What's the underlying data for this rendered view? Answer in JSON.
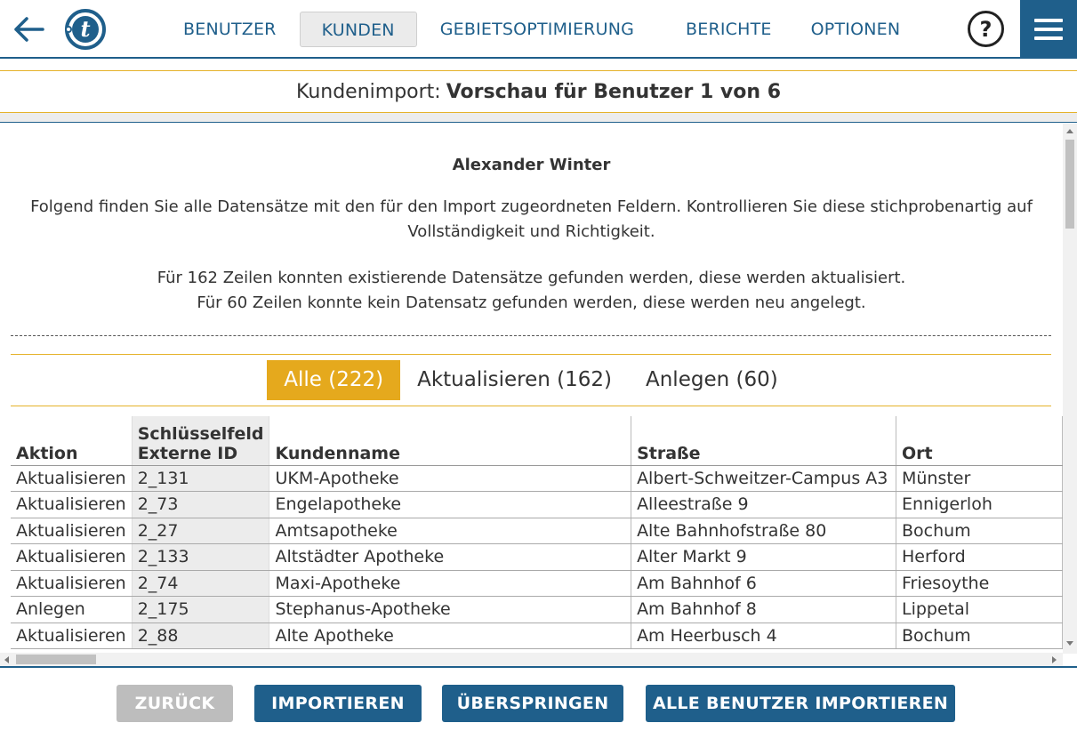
{
  "nav": {
    "items": [
      "BENUTZER",
      "KUNDEN",
      "GEBIETSOPTIMIERUNG",
      "BERICHTE",
      "OPTIONEN"
    ],
    "active": "KUNDEN",
    "help_label": "?",
    "logo_letter": "t"
  },
  "title": {
    "prefix": "Kundenimport:",
    "main": "Vorschau für Benutzer 1 von 6"
  },
  "content": {
    "user_name": "Alexander Winter",
    "description": "Folgend finden Sie alle Datensätze mit den für den Import zugeordneten Feldern. Kontrollieren Sie diese stichprobenartig auf Vollständigkeit und Richtigkeit.",
    "stat_update": "Für 162 Zeilen konnten existierende Datensätze gefunden werden, diese werden aktualisiert.",
    "stat_create": "Für 60 Zeilen konnte kein Datensatz gefunden werden, diese werden neu angelegt."
  },
  "filters": [
    {
      "label": "Alle (222)",
      "active": true
    },
    {
      "label": "Aktualisieren (162)",
      "active": false
    },
    {
      "label": "Anlegen (60)",
      "active": false
    }
  ],
  "table": {
    "headers": {
      "aktion": "Aktion",
      "key_line1": "Schlüsselfeld",
      "key_line2": "Externe ID",
      "name": "Kundenname",
      "street": "Straße",
      "city": "Ort"
    },
    "rows": [
      [
        "Aktualisieren",
        "2_131",
        "UKM-Apotheke",
        "Albert-Schweitzer-Campus A3",
        "Münster"
      ],
      [
        "Aktualisieren",
        "2_73",
        "Engelapotheke",
        "Alleestraße 9",
        "Ennigerloh"
      ],
      [
        "Aktualisieren",
        "2_27",
        "Amtsapotheke",
        "Alte Bahnhofstraße 80",
        "Bochum"
      ],
      [
        "Aktualisieren",
        "2_133",
        "Altstädter Apotheke",
        "Alter Markt 9",
        "Herford"
      ],
      [
        "Aktualisieren",
        "2_74",
        "Maxi-Apotheke",
        "Am Bahnhof 6",
        "Friesoythe"
      ],
      [
        "Anlegen",
        "2_175",
        "Stephanus-Apotheke",
        "Am Bahnhof 8",
        "Lippetal"
      ],
      [
        "Aktualisieren",
        "2_88",
        "Alte Apotheke",
        "Am Heerbusch 4",
        "Bochum"
      ]
    ]
  },
  "buttons": {
    "back": "ZURÜCK",
    "import": "IMPORTIEREN",
    "skip": "ÜBERSPRINGEN",
    "import_all": "ALLE BENUTZER IMPORTIEREN"
  },
  "colors": {
    "primary": "#1f5f8b",
    "accent": "#e5a91d",
    "disabled": "#bdbdbd"
  }
}
